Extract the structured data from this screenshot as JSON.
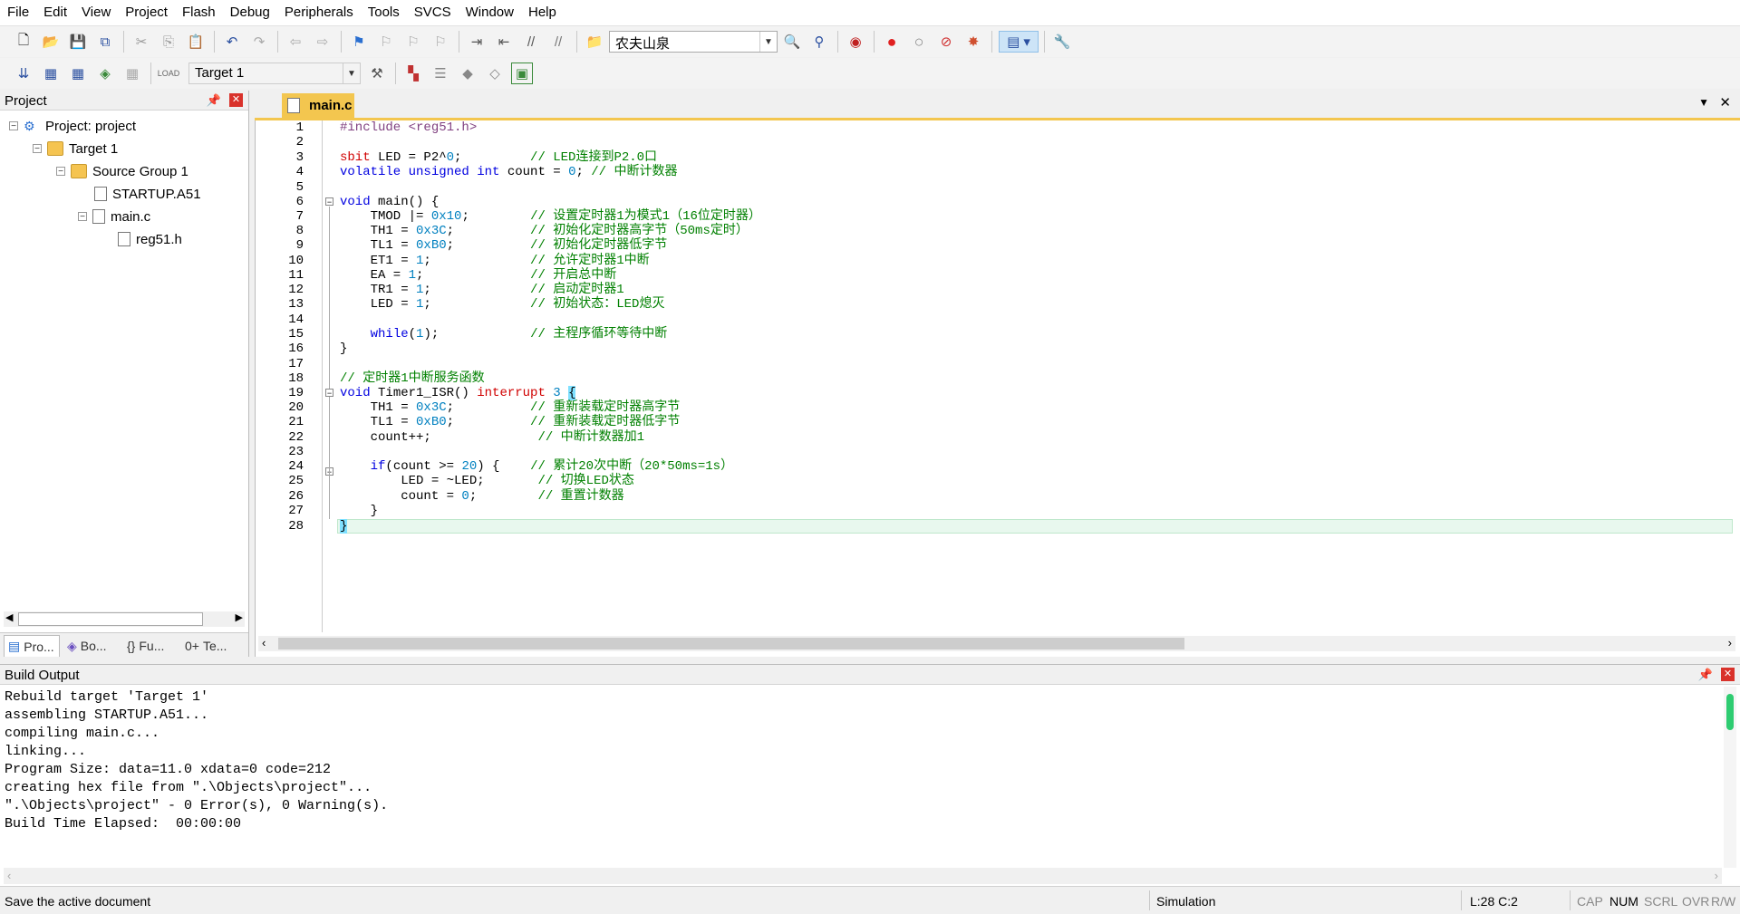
{
  "menu": [
    "File",
    "Edit",
    "View",
    "Project",
    "Flash",
    "Debug",
    "Peripherals",
    "Tools",
    "SVCS",
    "Window",
    "Help"
  ],
  "toolbar1": {
    "find_combo_value": "农夫山泉"
  },
  "toolbar2": {
    "target_combo_value": "Target 1",
    "load_label": "LOAD"
  },
  "project_panel": {
    "title": "Project",
    "tree": {
      "root": "Project: project",
      "target": "Target 1",
      "group": "Source Group 1",
      "file1": "STARTUP.A51",
      "file2": "main.c",
      "file3": "reg51.h"
    },
    "tabs": [
      "Pro...",
      "Bo...",
      "Fu...",
      "Te..."
    ],
    "tab_prefixes": [
      "{}",
      "0+"
    ]
  },
  "editor": {
    "tab_label": "main.c",
    "line_numbers": [
      "1",
      "2",
      "3",
      "4",
      "5",
      "6",
      "7",
      "8",
      "9",
      "10",
      "11",
      "12",
      "13",
      "14",
      "15",
      "16",
      "17",
      "18",
      "19",
      "20",
      "21",
      "22",
      "23",
      "24",
      "25",
      "26",
      "27",
      "28"
    ]
  },
  "build_output": {
    "title": "Build Output",
    "lines": [
      "Rebuild target 'Target 1'",
      "assembling STARTUP.A51...",
      "compiling main.c...",
      "linking...",
      "Program Size: data=11.0 xdata=0 code=212",
      "creating hex file from \".\\Objects\\project\"...",
      "\".\\Objects\\project\" - 0 Error(s), 0 Warning(s).",
      "Build Time Elapsed:  00:00:00"
    ]
  },
  "status": {
    "message": "Save the active document",
    "mode": "Simulation",
    "position": "L:28 C:2",
    "cap": "CAP",
    "num": "NUM",
    "scrl": "SCRL",
    "ovr": "OVR",
    "rw": "R/W"
  },
  "colors": {
    "tab_active": "#f3c64f",
    "current_line": "#e8f8ee",
    "keyword": "#0000e0",
    "comment": "#008000",
    "number": "#0080c0"
  }
}
